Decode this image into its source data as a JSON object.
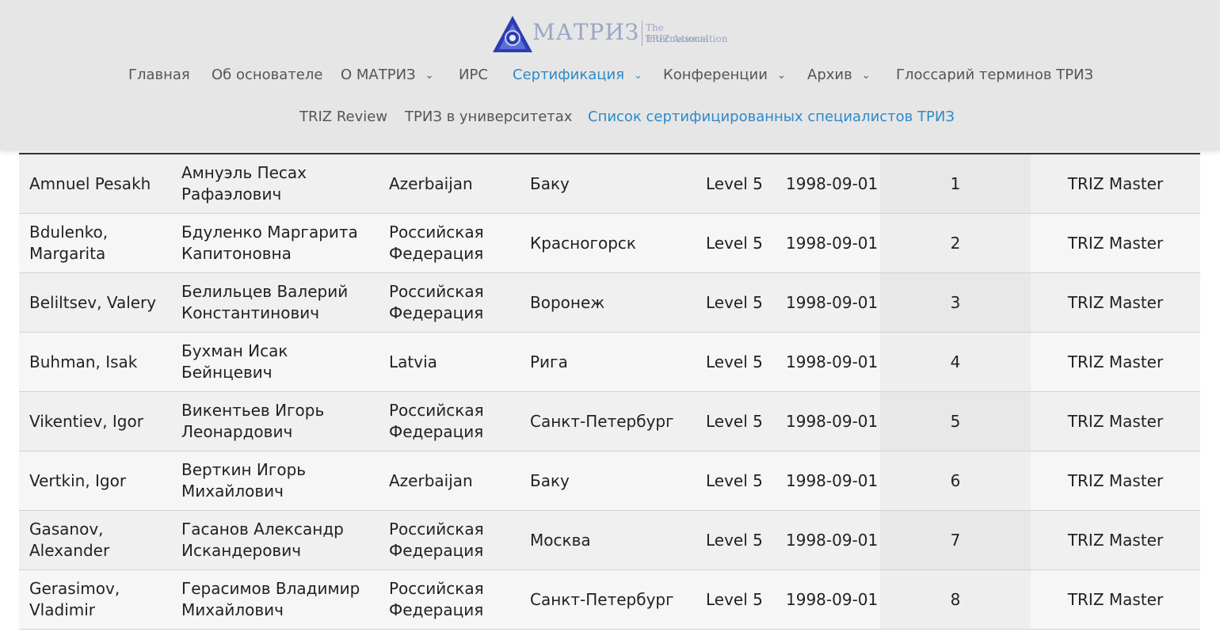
{
  "logo": {
    "name": "МАТРИЗ",
    "subtitle_line1": "The International",
    "subtitle_line2": "TRIZ Association"
  },
  "nav": {
    "row1": [
      {
        "label": "Главная"
      },
      {
        "label": "Об основателе"
      },
      {
        "label": "О МАТРИЗ"
      },
      {
        "label": "ИРС"
      },
      {
        "label": "Сертификация"
      },
      {
        "label": "Конференции"
      },
      {
        "label": "Архив"
      },
      {
        "label": "Глоссарий терминов ТРИЗ"
      }
    ],
    "row2": [
      {
        "label": "TRIZ Review"
      },
      {
        "label": "ТРИЗ в университетах"
      },
      {
        "label": "Список сертифицированных специалистов ТРИЗ"
      }
    ],
    "colors": {
      "active": "#2d8ac9",
      "default": "#555555"
    }
  },
  "table": {
    "rows": [
      {
        "name_en": "Amnuel Pesakh",
        "name_ru": "Амнуэль Песах Рафаэлович",
        "country": "Azerbaijan",
        "city": "Баку",
        "level": "Level 5",
        "date": "1998-09-01",
        "num": "1",
        "title": "TRIZ Master"
      },
      {
        "name_en": "Bdulenko, Margarita",
        "name_ru": "Бдуленко Маргарита Капитоновна",
        "country": "Российская Федерация",
        "city": "Красногорск",
        "level": "Level 5",
        "date": "1998-09-01",
        "num": "2",
        "title": "TRIZ Master"
      },
      {
        "name_en": "Beliltsev, Valery",
        "name_ru": "Белильцев Валерий Константинович",
        "country": "Российская Федерация",
        "city": "Воронеж",
        "level": "Level 5",
        "date": "1998-09-01",
        "num": "3",
        "title": "TRIZ Master"
      },
      {
        "name_en": "Buhman, Isak",
        "name_ru": "Бухман Исак Бейнцевич",
        "country": "Latvia",
        "city": "Рига",
        "level": "Level 5",
        "date": "1998-09-01",
        "num": "4",
        "title": "TRIZ Master"
      },
      {
        "name_en": "Vikentiev, Igor",
        "name_ru": "Викентьев Игорь Леонардович",
        "country": "Российская Федерация",
        "city": "Санкт-Петербург",
        "level": "Level 5",
        "date": "1998-09-01",
        "num": "5",
        "title": "TRIZ Master"
      },
      {
        "name_en": "Vertkin, Igor",
        "name_ru": "Верткин Игорь Михайлович",
        "country": "Azerbaijan",
        "city": "Баку",
        "level": "Level 5",
        "date": "1998-09-01",
        "num": "6",
        "title": "TRIZ Master"
      },
      {
        "name_en": "Gasanov, Alexander",
        "name_ru": "Гасанов Александр Искандерович",
        "country": "Российская Федерация",
        "city": "Москва",
        "level": "Level 5",
        "date": "1998-09-01",
        "num": "7",
        "title": "TRIZ Master"
      },
      {
        "name_en": "Gerasimov, Vladimir",
        "name_ru": "Герасимов Владимир Михайлович",
        "country": "Российская Федерация",
        "city": "Санкт-Петербург",
        "level": "Level 5",
        "date": "1998-09-01",
        "num": "8",
        "title": "TRIZ Master"
      }
    ]
  }
}
